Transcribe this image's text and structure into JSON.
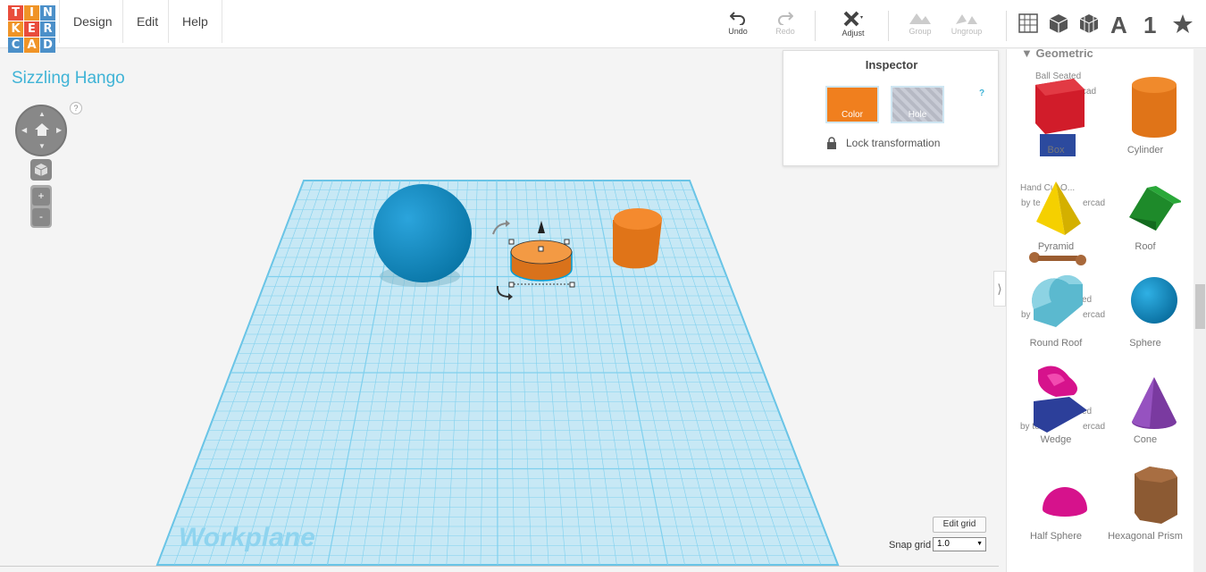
{
  "app": {
    "logo_letters": [
      "T",
      "I",
      "N",
      "K",
      "E",
      "R",
      "C",
      "A",
      "D"
    ],
    "logo_colors": [
      "#e94d3c",
      "#f09427",
      "#4c90c9",
      "#f09427",
      "#e94d3c",
      "#4c90c9",
      "#4c90c9",
      "#f09427",
      "#4c90c9"
    ],
    "menu": [
      "Design",
      "Edit",
      "Help"
    ],
    "project_title": "Sizzling Hango"
  },
  "toolbar": {
    "undo": "Undo",
    "redo": "Redo",
    "adjust": "Adjust",
    "group": "Group",
    "ungroup": "Ungroup",
    "text_a": "A",
    "number_1": "1"
  },
  "view": {
    "help": "?",
    "zoom_in": "+",
    "zoom_out": "-"
  },
  "inspector": {
    "title": "Inspector",
    "color_label": "Color",
    "color_value": "#f07f1e",
    "hole_label": "Hole",
    "help": "?",
    "lock_label": "Lock transformation"
  },
  "panel": {
    "section": "Geometric",
    "partial_labels": {
      "ball_seated": "Ball Seated",
      "cad_top": "cad",
      "hand_cut": "Hand Cut O...",
      "by_tinkercad_1": "by te",
      "ercad_1": "ercad",
      "ed_1": "ed",
      "by_1": "by",
      "ercad_2": "ercad",
      "ed_2": "ed",
      "by_tinkercad_2": "by team",
      "ercad_3": "ercad"
    },
    "shapes": [
      {
        "name": "Box"
      },
      {
        "name": "Cylinder"
      },
      {
        "name": "Pyramid"
      },
      {
        "name": "Roof"
      },
      {
        "name": "Round Roof"
      },
      {
        "name": "Sphere"
      },
      {
        "name": "Wedge"
      },
      {
        "name": "Cone"
      },
      {
        "name": "Half Sphere"
      },
      {
        "name": "Hexagonal Prism"
      }
    ]
  },
  "workplane": {
    "label": "Workplane",
    "edit_grid": "Edit grid",
    "snap_label": "Snap grid",
    "snap_value": "1.0"
  }
}
